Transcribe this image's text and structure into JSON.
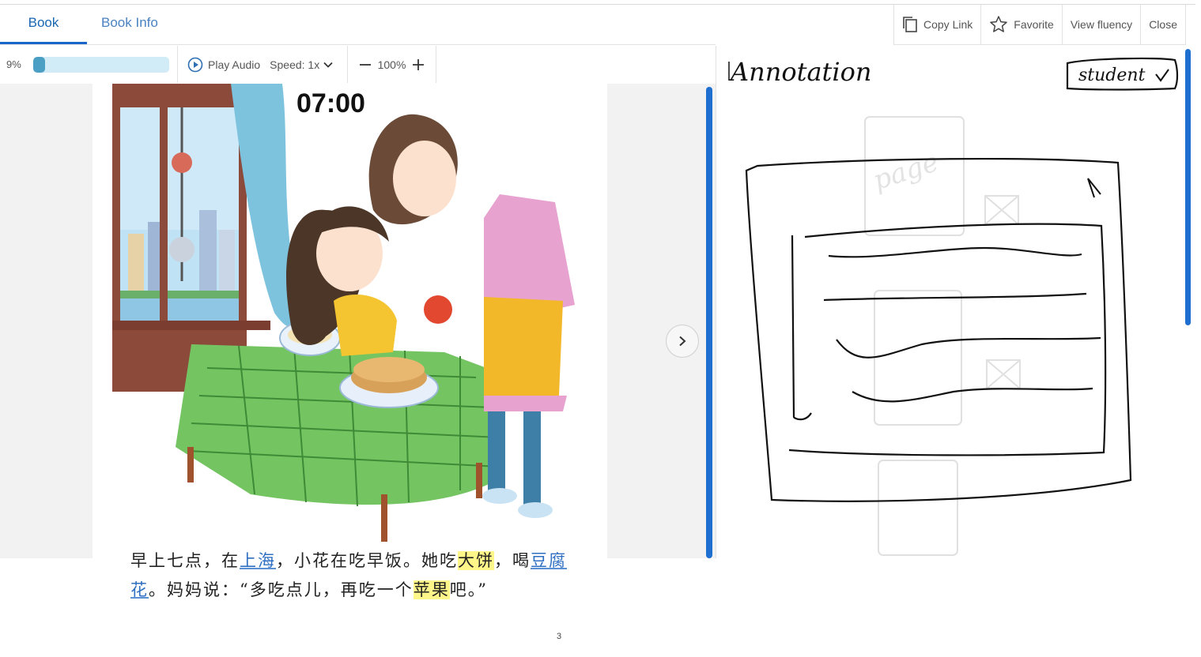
{
  "tabs": [
    {
      "label": "Book",
      "active": true
    },
    {
      "label": "Book Info",
      "active": false
    }
  ],
  "actions": {
    "copy_link": "Copy Link",
    "favorite": "Favorite",
    "view_fluency": "View fluency",
    "close": "Close"
  },
  "progress": {
    "label": "9%",
    "value": 0.09
  },
  "audio": {
    "play_label": "Play Audio",
    "speed_label": "Speed: 1x"
  },
  "zoom": {
    "level": "100%"
  },
  "page": {
    "clock": "07:00",
    "text_segments": [
      {
        "text": "早上七点，在",
        "style": "plain"
      },
      {
        "text": "上海",
        "style": "blue"
      },
      {
        "text": "，小花在吃早饭。她吃",
        "style": "plain"
      },
      {
        "text": "大饼",
        "style": "yellow"
      },
      {
        "text": "，喝",
        "style": "plain"
      },
      {
        "text": "豆腐花",
        "style": "blue"
      },
      {
        "text": "。妈妈说：“多吃点儿，再吃一个",
        "style": "plain"
      },
      {
        "text": "苹果",
        "style": "yellow"
      },
      {
        "text": "吧。”",
        "style": "plain"
      }
    ],
    "page_number": "3"
  },
  "annotation": {
    "title_handwritten": "Annotation",
    "role_handwritten": "student",
    "bg_word": "page"
  },
  "colors": {
    "accent": "#1f6fd1",
    "progress_fill": "#4b9ec4",
    "progress_track": "#d1ecf6",
    "highlight_yellow": "#fff68a",
    "link_blue": "#2f6fc2"
  }
}
